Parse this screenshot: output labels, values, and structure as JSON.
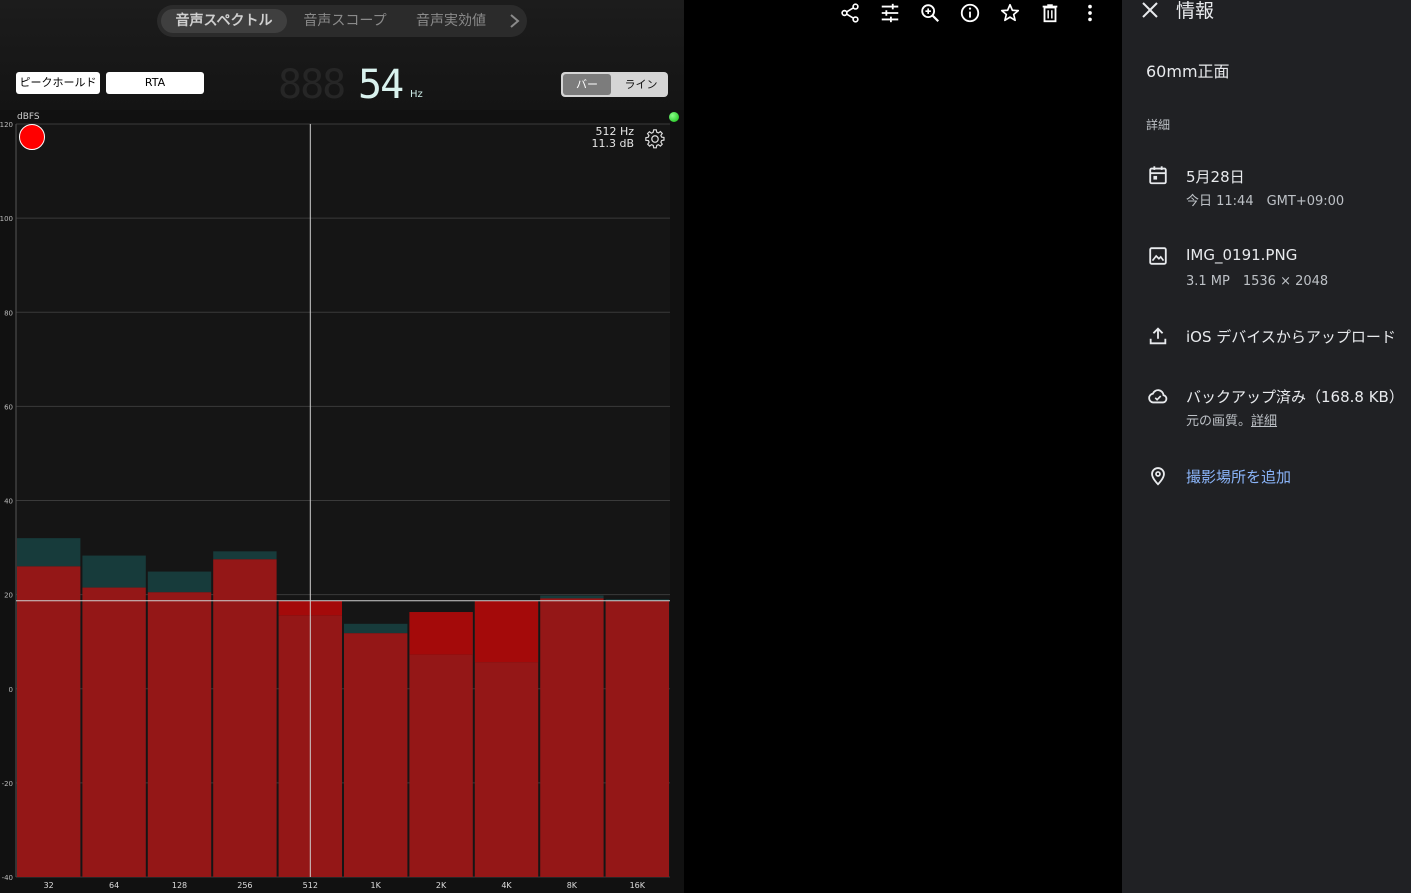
{
  "app": {
    "tabs": [
      "音声スペクトル",
      "音声スコープ",
      "音声実効値"
    ],
    "active_tab": 0,
    "peak_hold_label": "ピークホールド",
    "rta_label": "RTA",
    "freq_digits": "54",
    "freq_ghost": "888",
    "freq_unit": "Hz",
    "view_bar_label": "バー",
    "view_line_label": "ライン",
    "readout_freq": "512 Hz",
    "readout_db": "11.3 dB",
    "colors": {
      "bar": "#941717",
      "peak": "#173b3b",
      "hot": "#a40a0a",
      "accent_dot": "#22cc22"
    }
  },
  "chart_data": {
    "type": "bar",
    "ylabel": "dBFS",
    "ylim": [
      -40,
      120
    ],
    "yticks": [
      120,
      100,
      80,
      60,
      40,
      20,
      0,
      -20,
      -40
    ],
    "categories": [
      "32",
      "64",
      "128",
      "256",
      "512",
      "1K",
      "2K",
      "4K",
      "8K",
      "16K"
    ],
    "series": [
      {
        "values": [
          26,
          21.5,
          20.5,
          27.5,
          15.5,
          11.8,
          7.2,
          5.6,
          19.2,
          18.7
        ]
      },
      {
        "values": [
          32,
          28.3,
          24.9,
          29.2,
          18.7,
          13.8,
          16.3,
          18.7,
          19.8,
          19
        ]
      }
    ],
    "hot_range": [
      [
        15.5,
        18.7
      ],
      [],
      [],
      [],
      [
        15.5,
        18.7
      ],
      [],
      [
        7.2,
        16.3
      ],
      [
        5.6,
        18.7
      ],
      [],
      []
    ],
    "cursor_x": "512",
    "cursor_y": 18.7,
    "grid": true
  },
  "toolbar": {
    "icons": [
      "share-icon",
      "tune-icon",
      "zoom-in-icon",
      "info-icon",
      "star-icon",
      "trash-icon",
      "more-vert-icon"
    ]
  },
  "panel": {
    "title": "情報",
    "name": "60mm正面",
    "details_label": "詳細",
    "date_main": "5月28日",
    "date_sub": "今日 11:44　GMT+09:00",
    "file_main": "IMG_0191.PNG",
    "file_sub": "3.1 MP　1536 × 2048",
    "upload_main": "iOS デバイスからアップロード",
    "backup_main": "バックアップ済み（168.8 KB）",
    "backup_sub": "元の画質。",
    "backup_link": "詳細",
    "location_link": "撮影場所を追加"
  }
}
